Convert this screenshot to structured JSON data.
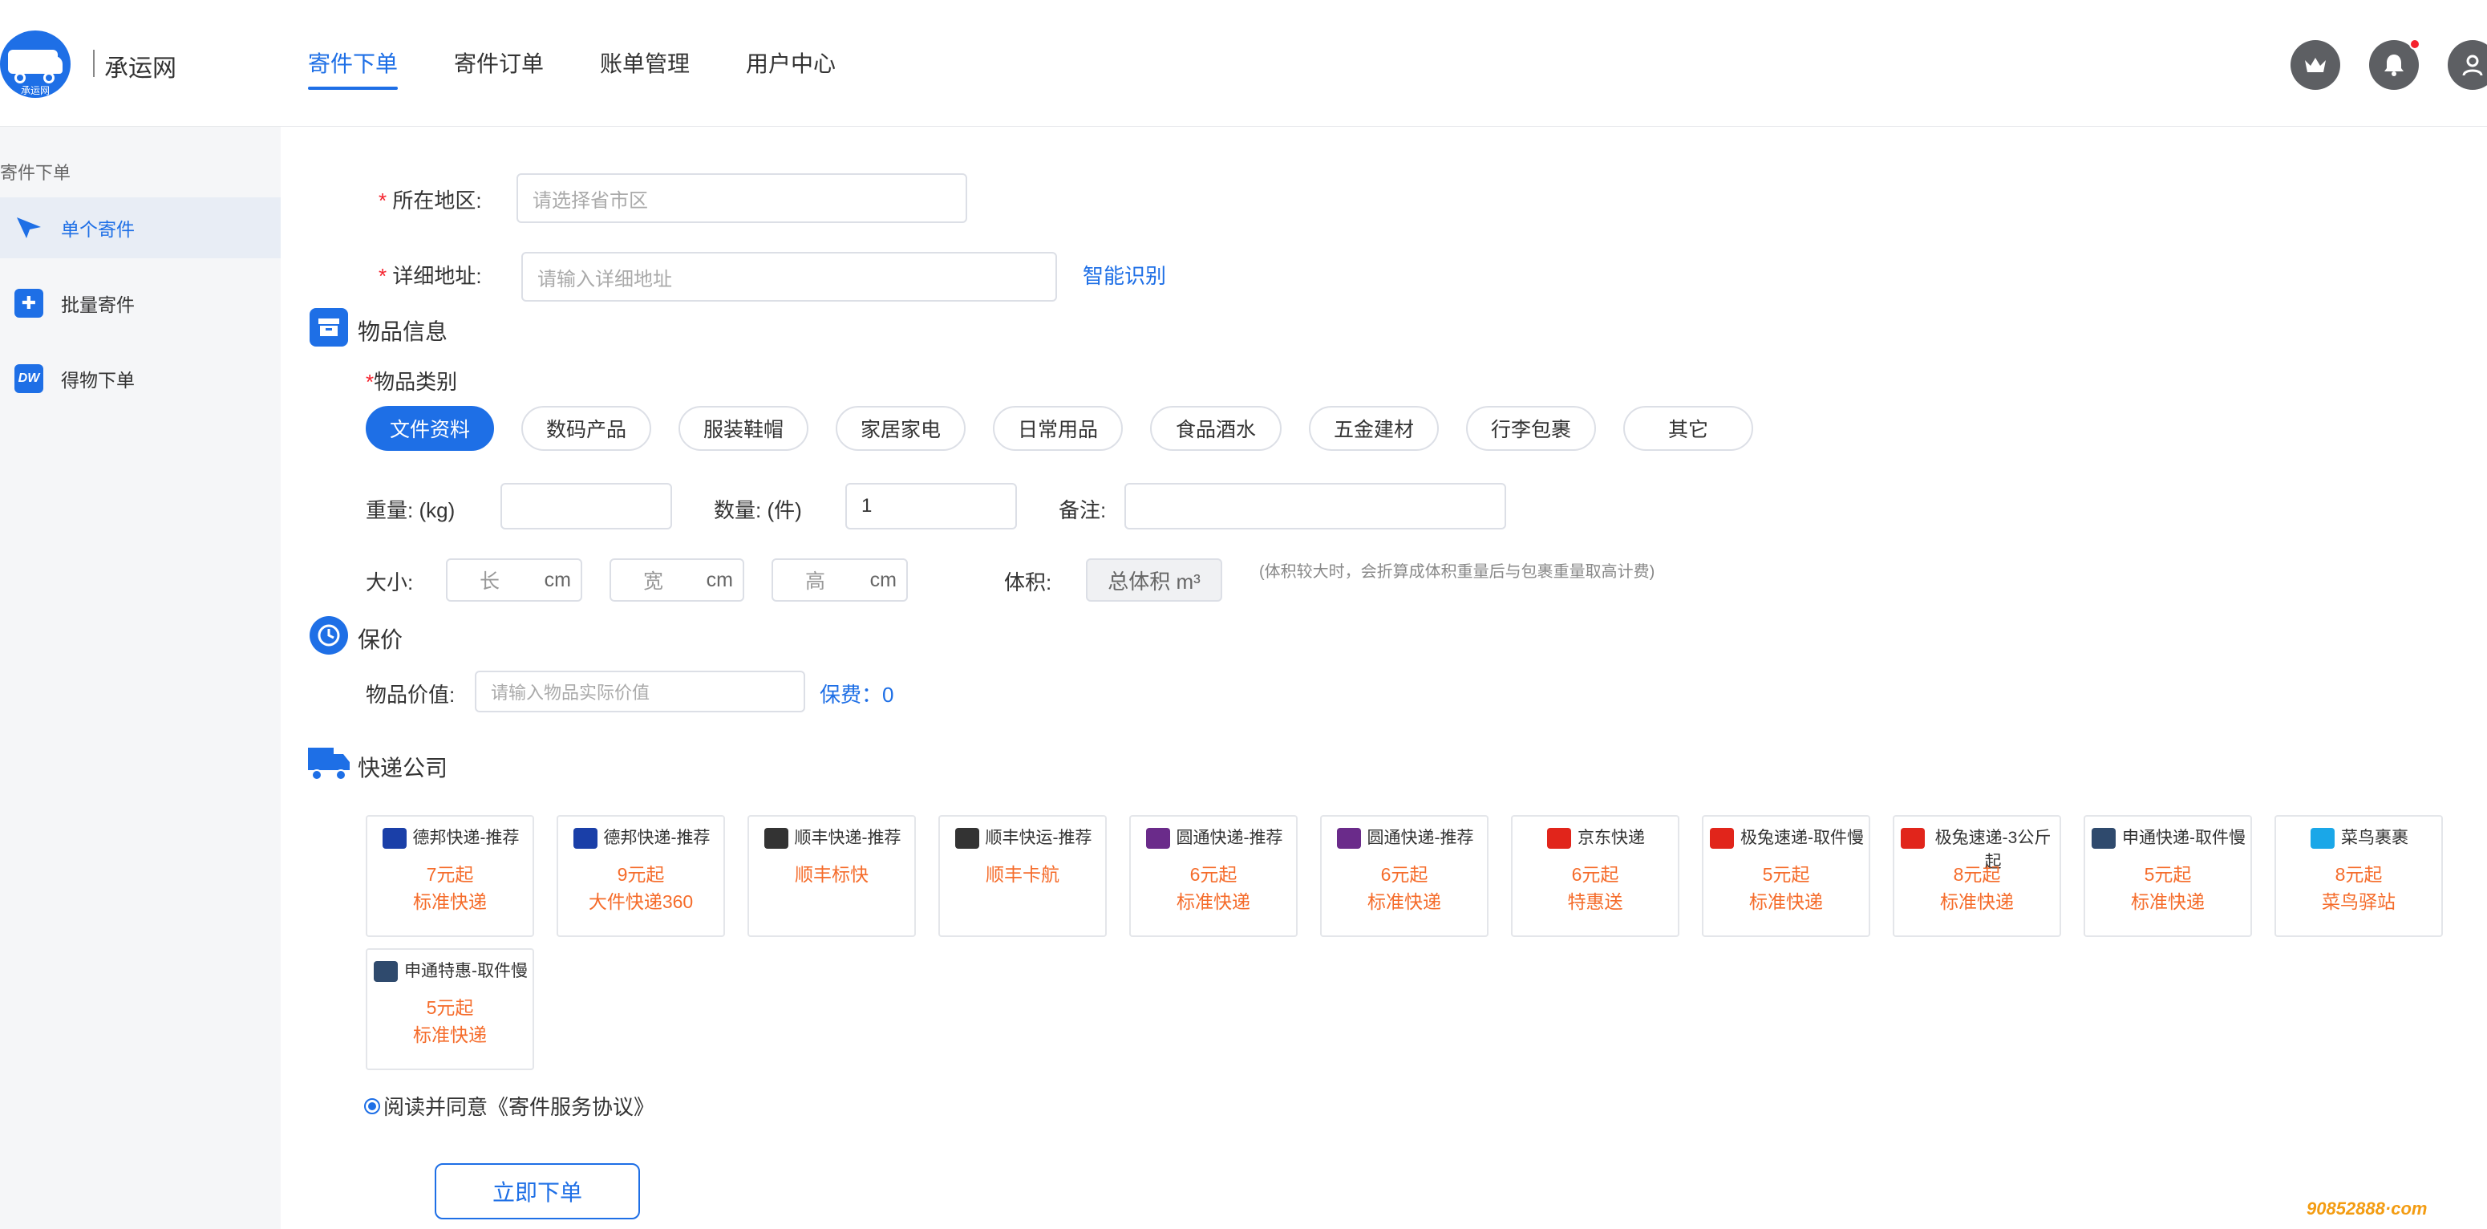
{
  "header": {
    "logo_text": "承运网",
    "logo_badge": "承运网",
    "nav": [
      "寄件下单",
      "寄件订单",
      "账单管理",
      "用户中心"
    ]
  },
  "sidebar": {
    "title": "寄件下单",
    "items": [
      {
        "label": "单个寄件",
        "icon": "send-arrow-icon"
      },
      {
        "label": "批量寄件",
        "icon": "batch-box-icon"
      },
      {
        "label": "得物下单",
        "icon": "dw-icon"
      }
    ]
  },
  "address": {
    "region_label": "所在地区:",
    "region_placeholder": "请选择省市区",
    "detail_label": "详细地址:",
    "detail_placeholder": "请输入详细地址",
    "smart_recognize": "智能识别"
  },
  "goods": {
    "title": "物品信息",
    "category_label": "物品类别",
    "categories": [
      "文件资料",
      "数码产品",
      "服装鞋帽",
      "家居家电",
      "日常用品",
      "食品酒水",
      "五金建材",
      "行李包裹",
      "其它"
    ],
    "selected_category": "文件资料",
    "weight_label": "重量: (kg)",
    "quantity_label": "数量: (件)",
    "quantity_value": "1",
    "remark_label": "备注:",
    "size_label": "大小:",
    "length": "长",
    "width": "宽",
    "height": "高",
    "unit_cm": "cm",
    "volume_label": "体积:",
    "volume_box": "总体积 m³",
    "volume_hint": "(体积较大时，会折算成体积重量后与包裹重量取高计费)"
  },
  "insurance": {
    "title": "保价",
    "value_label": "物品价值:",
    "value_placeholder": "请输入物品实际价值",
    "fee": "保费：0"
  },
  "couriers": {
    "title": "快递公司",
    "items": [
      {
        "name": "德邦快递-推荐",
        "price": "7元起",
        "service": "标准快递",
        "icon_color": "#1a3fa8",
        "icon": "deppon-logo-icon"
      },
      {
        "name": "德邦快递-推荐",
        "price": "9元起",
        "service": "大件快递360",
        "icon_color": "#1a3fa8",
        "icon": "deppon-logo-icon"
      },
      {
        "name": "顺丰快递-推荐",
        "price": "",
        "service": "顺丰标快",
        "icon_color": "#333333",
        "icon": "sf-logo-icon"
      },
      {
        "name": "顺丰快运-推荐",
        "price": "",
        "service": "顺丰卡航",
        "icon_color": "#333333",
        "icon": "sf-logo-icon"
      },
      {
        "name": "圆通快递-推荐",
        "price": "6元起",
        "service": "标准快递",
        "icon_color": "#6a2b8a",
        "icon": "yto-logo-icon"
      },
      {
        "name": "圆通快递-推荐",
        "price": "6元起",
        "service": "标准快递",
        "icon_color": "#6a2b8a",
        "icon": "yto-logo-icon"
      },
      {
        "name": "京东快递",
        "price": "6元起",
        "service": "特惠送",
        "icon_color": "#e1251b",
        "icon": "jd-logo-icon"
      },
      {
        "name": "极兔速递-取件慢",
        "price": "5元起",
        "service": "标准快递",
        "icon_color": "#e1251b",
        "icon": "jt-logo-icon"
      },
      {
        "name": "极兔速递-3公斤起",
        "price": "8元起",
        "service": "标准快递",
        "icon_color": "#e1251b",
        "icon": "jt-logo-icon"
      },
      {
        "name": "申通快递-取件慢",
        "price": "5元起",
        "service": "标准快递",
        "icon_color": "#2f4a6d",
        "icon": "sto-logo-icon"
      },
      {
        "name": "菜鸟裹裹",
        "price": "8元起",
        "service": "菜鸟驿站",
        "icon_color": "#1aa7e8",
        "icon": "cainiao-logo-icon"
      },
      {
        "name": "申通特惠-取件慢",
        "price": "5元起",
        "service": "标准快递",
        "icon_color": "#2f4a6d",
        "icon": "sto-logo-icon"
      }
    ]
  },
  "agreement": "阅读并同意《寄件服务协议》",
  "submit": "立即下单",
  "watermark": "90852888·com",
  "colors": {
    "accent": "#1e6fe6",
    "price": "#f56c2b",
    "required": "#f5222d"
  }
}
